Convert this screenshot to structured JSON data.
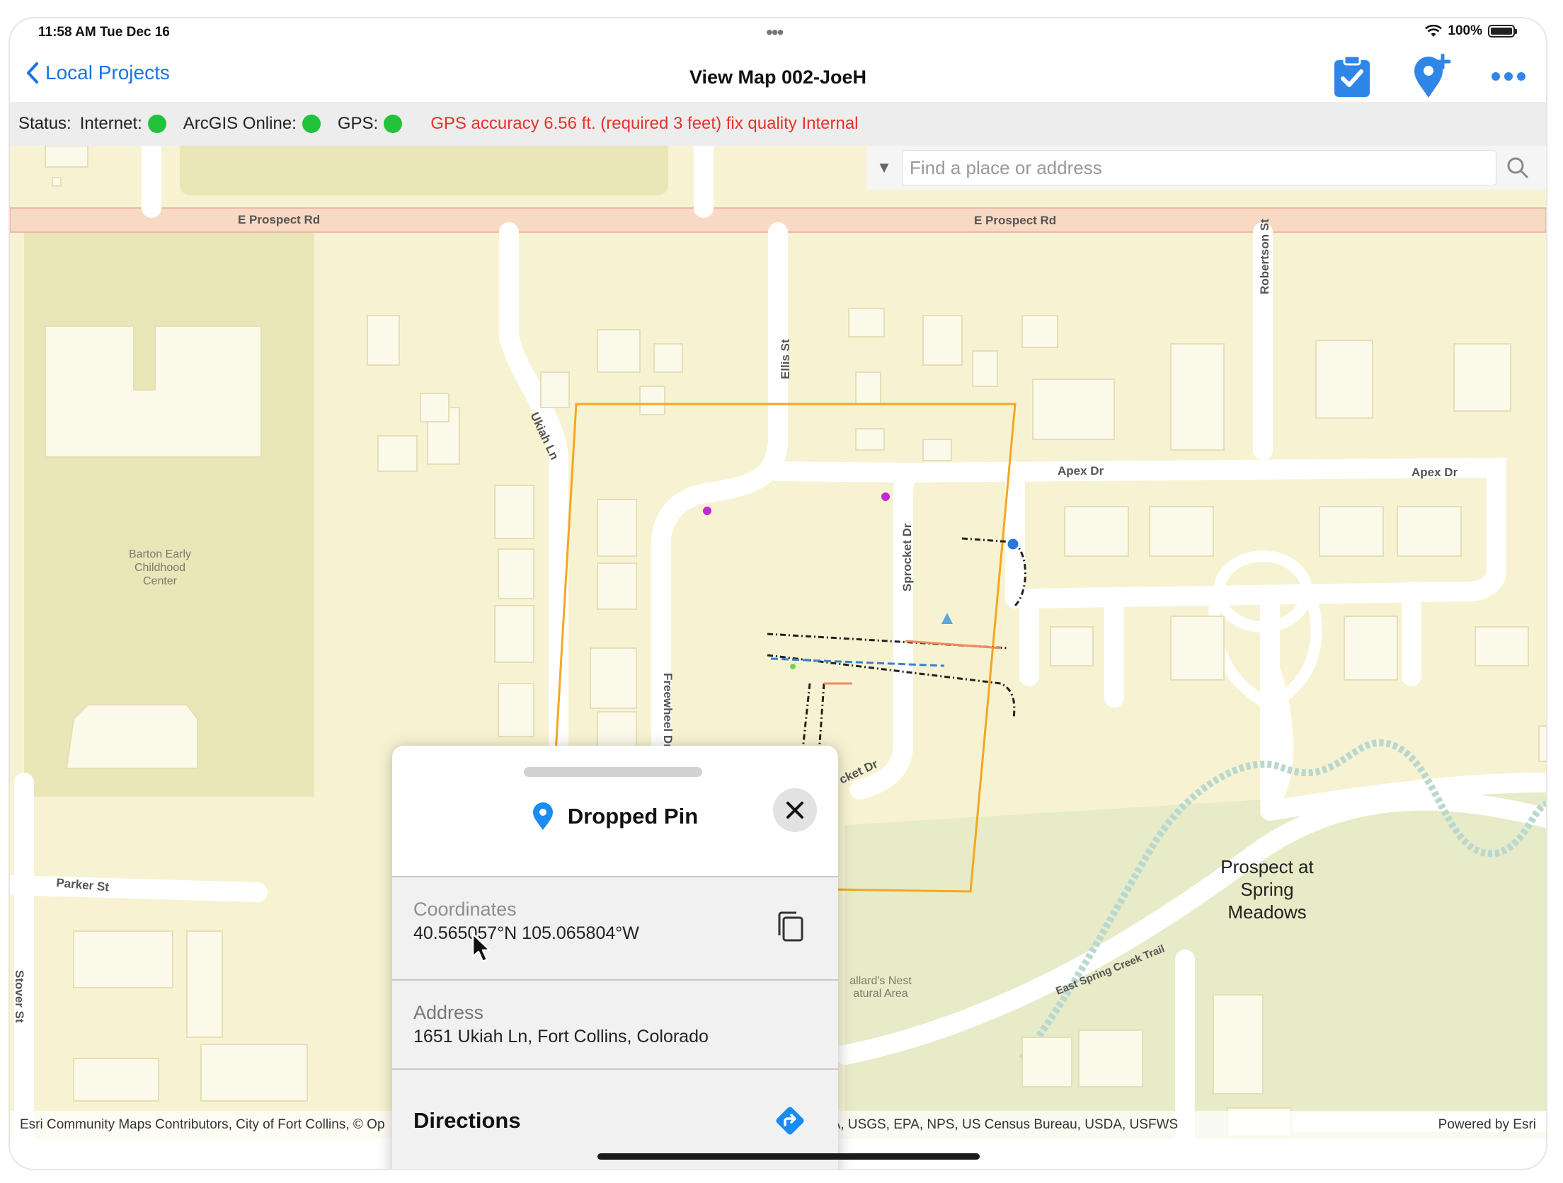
{
  "status_bar": {
    "time": "11:58 AM  Tue Dec 16",
    "battery": "100%"
  },
  "nav": {
    "back_label": "Local Projects",
    "title": "View Map 002-JoeH",
    "icons": [
      "clipboard-check-icon",
      "add-pin-icon",
      "more-icon"
    ]
  },
  "status_row": {
    "status_label": "Status:",
    "internet_label": "Internet:",
    "arcgis_label": "ArcGIS Online:",
    "gps_label": "GPS:",
    "gps_warning": "GPS accuracy 6.56 ft. (required 3 feet) fix quality Internal",
    "indicator_color": "#22c33a",
    "warning_color": "#e5322b"
  },
  "search": {
    "placeholder": "Find a place or address"
  },
  "map_labels": {
    "prospect_rd_1": "E Prospect Rd",
    "prospect_rd_2": "E Prospect Rd",
    "robertson": "Robertson St",
    "ellis": "Ellis St",
    "ukiah": "Ukiah Ln",
    "sprocket": "Sprocket Dr",
    "apex_1": "Apex Dr",
    "apex_2": "Apex Dr",
    "freewheel": "Freewheel Dr",
    "ucket": "cket Dr",
    "ln": "Ln",
    "barton_1": "Barton Early",
    "barton_2": "Childhood",
    "barton_3": "Center",
    "parker": "Parker St",
    "stover": "Stover St",
    "prospect_spring_1": "Prospect at",
    "prospect_spring_2": "Spring",
    "prospect_spring_3": "Meadows",
    "trail": "East Spring Creek Trail",
    "nest_1": "allard's Nest",
    "nest_2": "atural Area"
  },
  "attribution": {
    "left": "Esri Community Maps Contributors, City of Fort Collins, © Op",
    "middle": "gies, Inc, METI/NASA, USGS, EPA, NPS, US Census Bureau, USDA, USFWS",
    "right": "Powered by Esri"
  },
  "callout": {
    "title": "Dropped Pin",
    "coordinates_label": "Coordinates",
    "coordinates_value": "40.565057°N  105.065804°W",
    "address_label": "Address",
    "address_value": "1651 Ukiah Ln, Fort Collins, Colorado",
    "directions_label": "Directions"
  },
  "colors": {
    "accent": "#1a73e8",
    "map_bg": "#f7f3d2",
    "road": "#ffffff",
    "major_road": "#f7d9c4",
    "project_boundary": "#f5a623"
  }
}
